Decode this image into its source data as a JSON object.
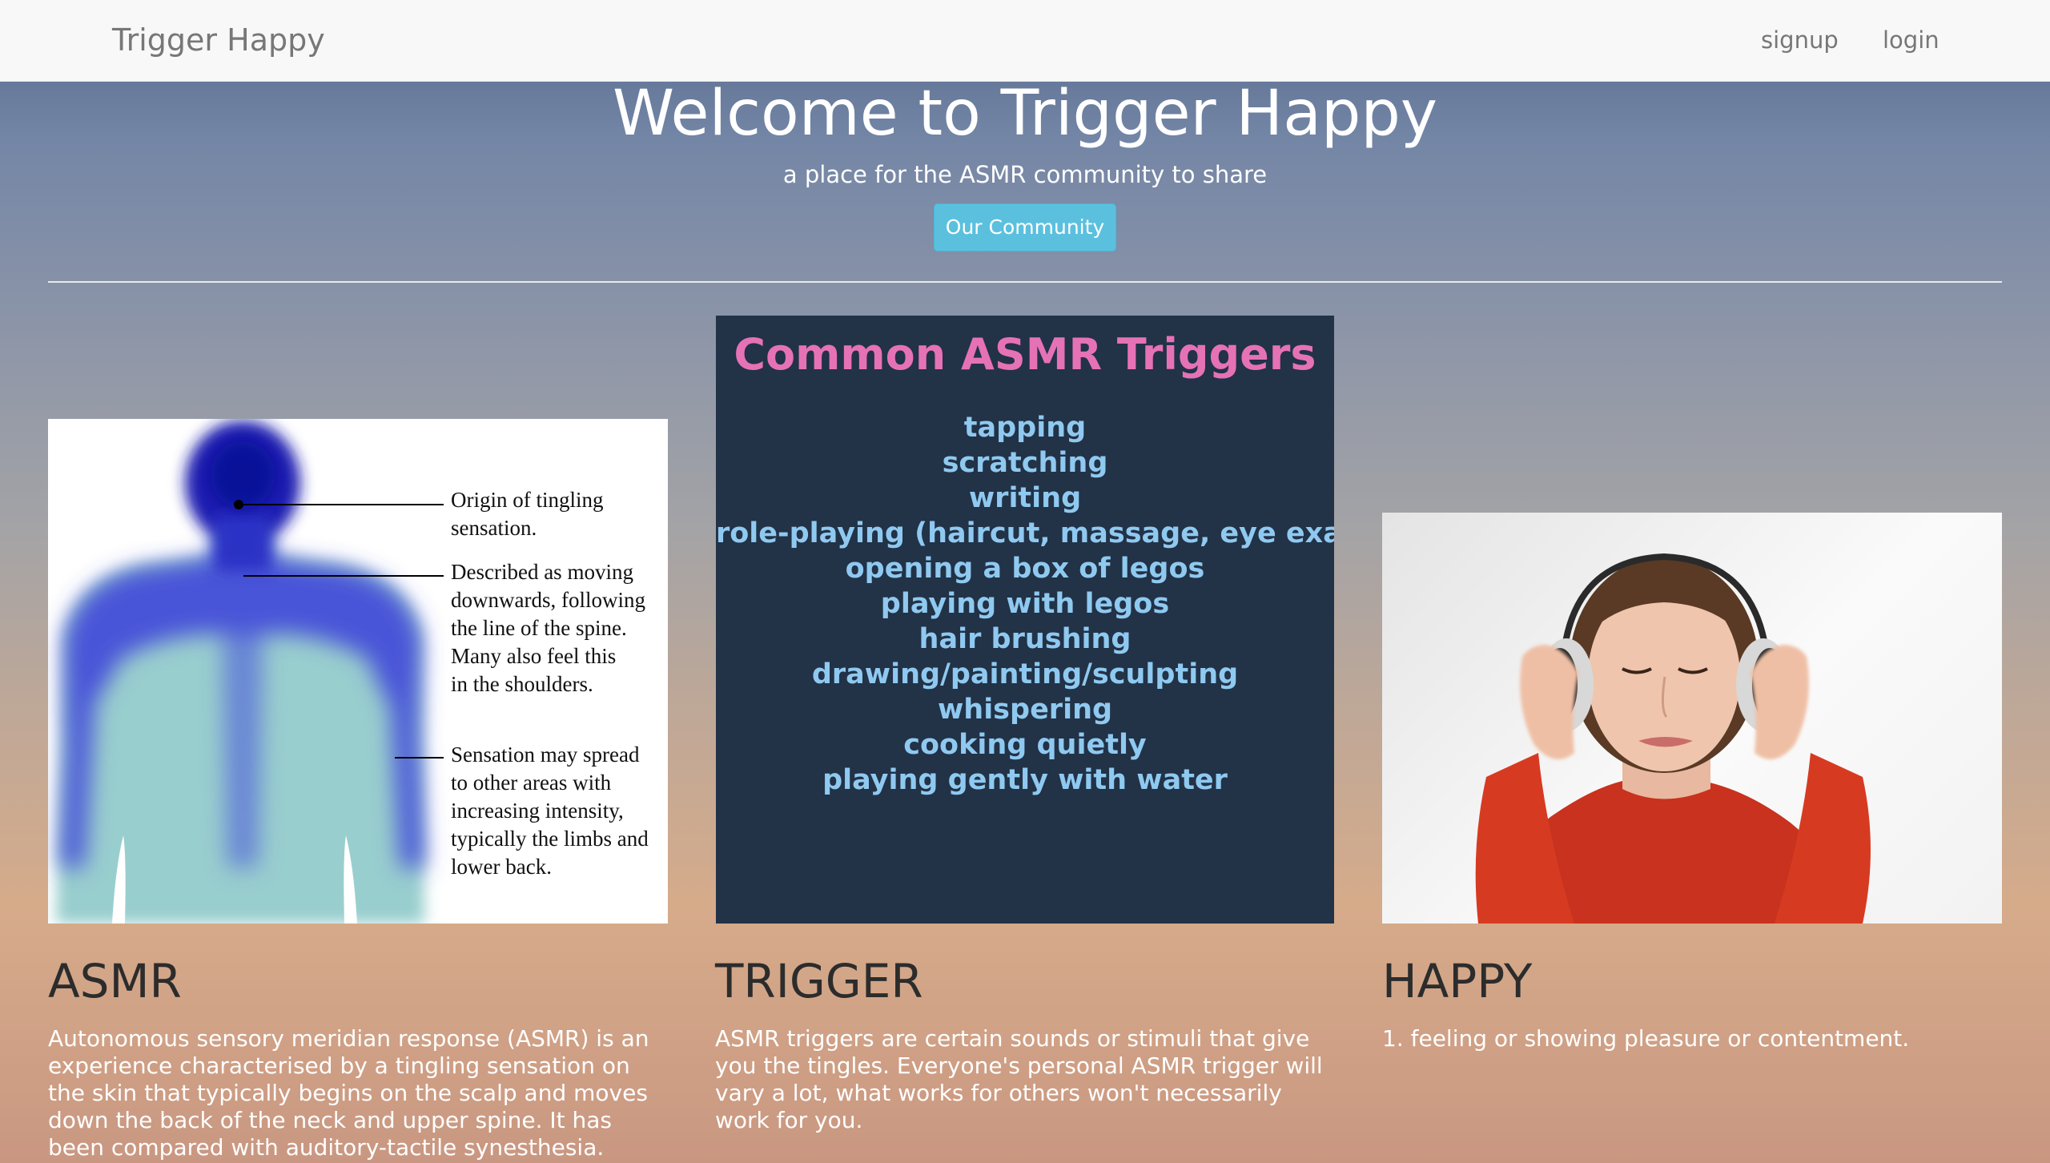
{
  "navbar": {
    "brand": "Trigger Happy",
    "links": [
      {
        "label": "signup"
      },
      {
        "label": "login"
      }
    ]
  },
  "hero": {
    "title": "Welcome to Trigger Happy",
    "subtitle": "a place for the ASMR community to share",
    "button_label": "Our Community",
    "button_color": "#5bc0de"
  },
  "asmr_diagram": {
    "annotations": [
      "Origin of tingling\nsensation.",
      "Described as moving\ndownwards, following\nthe line of the spine.\nMany also feel this\nin the shoulders.",
      "Sensation may spread\nto other areas with\nincreasing intensity,\ntypically the limbs and\nlower back."
    ]
  },
  "trigger_poster": {
    "title": "Common ASMR Triggers",
    "items": [
      "tapping",
      "scratching",
      "writing",
      "role-playing (haircut, massage, eye exam)",
      "opening a box of legos",
      "playing with legos",
      "hair brushing",
      "drawing/painting/sculpting",
      "whispering",
      "cooking quietly",
      "playing gently with water"
    ]
  },
  "columns": {
    "asmr": {
      "title": "ASMR",
      "text": "Autonomous sensory meridian response (ASMR) is an experience characterised by a tingling sensation on the skin that typically begins on the scalp and moves down the back of the neck and upper spine. It has been compared with auditory-tactile synesthesia."
    },
    "trigger": {
      "title": "TRIGGER",
      "text": "ASMR triggers are certain sounds or stimuli that give you the tingles. Everyone's personal ASMR trigger will vary a lot, what works for others won't necessarily work for you."
    },
    "happy": {
      "title": "HAPPY",
      "text": "1. feeling or showing pleasure or contentment."
    }
  }
}
